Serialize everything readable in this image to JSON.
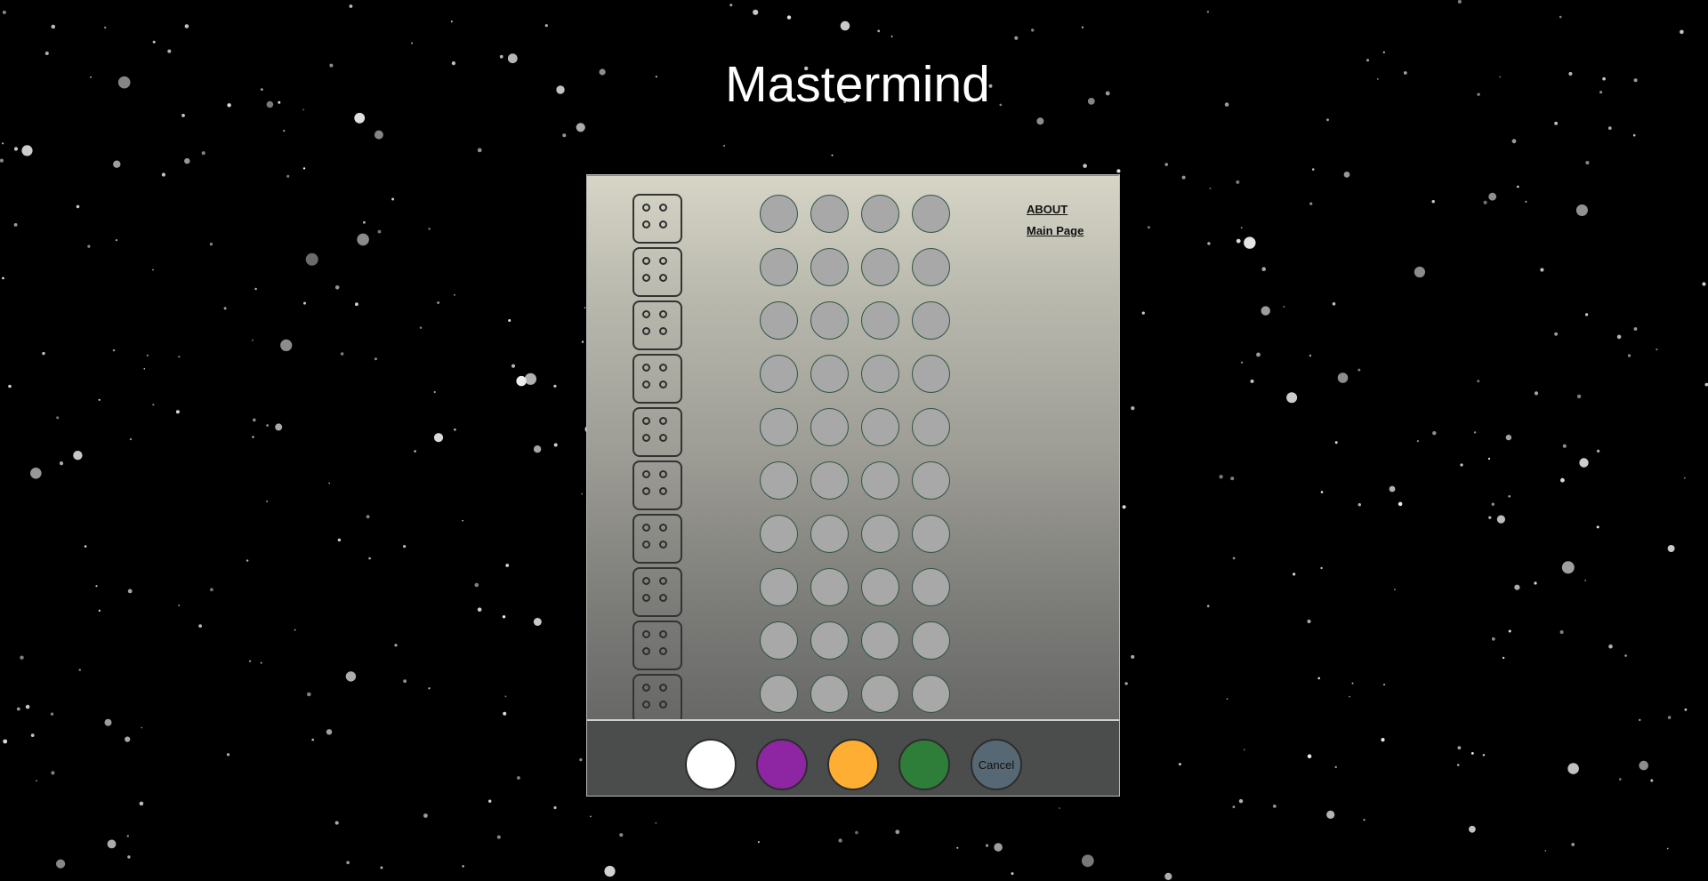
{
  "title": "Mastermind",
  "links": {
    "about": "ABOUT",
    "main_page": "Main Page"
  },
  "board": {
    "rows": 10,
    "holes_per_row": 4,
    "hole_color": "#a8a8a8"
  },
  "palette": {
    "colors": [
      {
        "name": "white",
        "hex": "#ffffff"
      },
      {
        "name": "purple",
        "hex": "#8e25a3"
      },
      {
        "name": "orange",
        "hex": "#ffae34"
      },
      {
        "name": "green",
        "hex": "#2e7e3a"
      }
    ],
    "cancel_label": "Cancel"
  },
  "colors": {
    "background": "#000000",
    "title": "#ffffff",
    "palette_bar": "#4b4c4c"
  }
}
